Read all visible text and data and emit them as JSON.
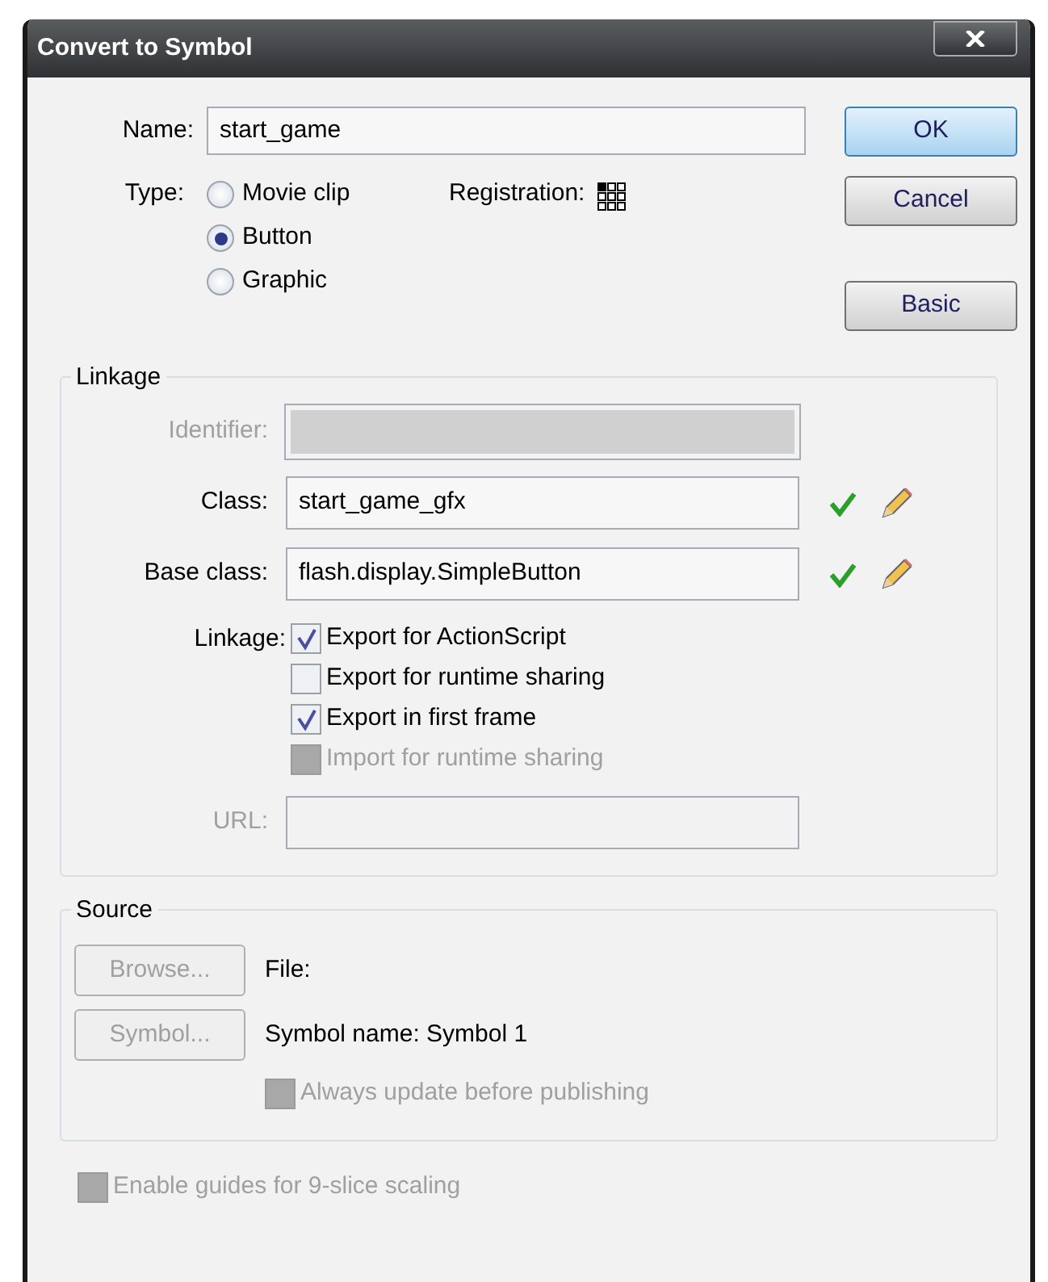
{
  "window": {
    "title": "Convert to Symbol"
  },
  "name": {
    "label": "Name:",
    "value": "start_game"
  },
  "type": {
    "label": "Type:",
    "options": [
      {
        "label": "Movie clip",
        "selected": false
      },
      {
        "label": "Button",
        "selected": true
      },
      {
        "label": "Graphic",
        "selected": false
      }
    ]
  },
  "registration": {
    "label": "Registration:"
  },
  "buttons": [
    {
      "label": "OK",
      "default": true
    },
    {
      "label": "Cancel",
      "default": false
    },
    {
      "label": "Basic",
      "default": false
    }
  ],
  "linkage": {
    "title": "Linkage",
    "fields": [
      {
        "label": "Identifier:",
        "disabled": true,
        "kind": "plain"
      },
      {
        "label": "Class:",
        "value": "start_game_gfx",
        "disabled": false,
        "kind": "class"
      },
      {
        "label": "Base class:",
        "value": "flash.display.SimpleButton",
        "disabled": false,
        "kind": "class"
      }
    ],
    "options_label": "Linkage:",
    "options": [
      {
        "label": "Export for ActionScript",
        "checked": true,
        "disabled": false
      },
      {
        "label": "Export for runtime sharing",
        "checked": false,
        "disabled": false
      },
      {
        "label": "Export in first frame",
        "checked": true,
        "disabled": false
      },
      {
        "label": "Import for runtime sharing",
        "checked": false,
        "disabled": true
      }
    ],
    "url": {
      "label": "URL:",
      "disabled": true
    }
  },
  "source": {
    "title": "Source",
    "rows": [
      {
        "button": "Browse...",
        "disabled": true,
        "text": "File:"
      },
      {
        "button": "Symbol...",
        "disabled": true,
        "text": "Symbol name: Symbol 1"
      }
    ],
    "option": {
      "label": "Always update before publishing",
      "checked": false,
      "disabled": true
    }
  },
  "footer_option": {
    "label": "Enable guides for 9-slice scaling",
    "checked": false,
    "disabled": true
  }
}
